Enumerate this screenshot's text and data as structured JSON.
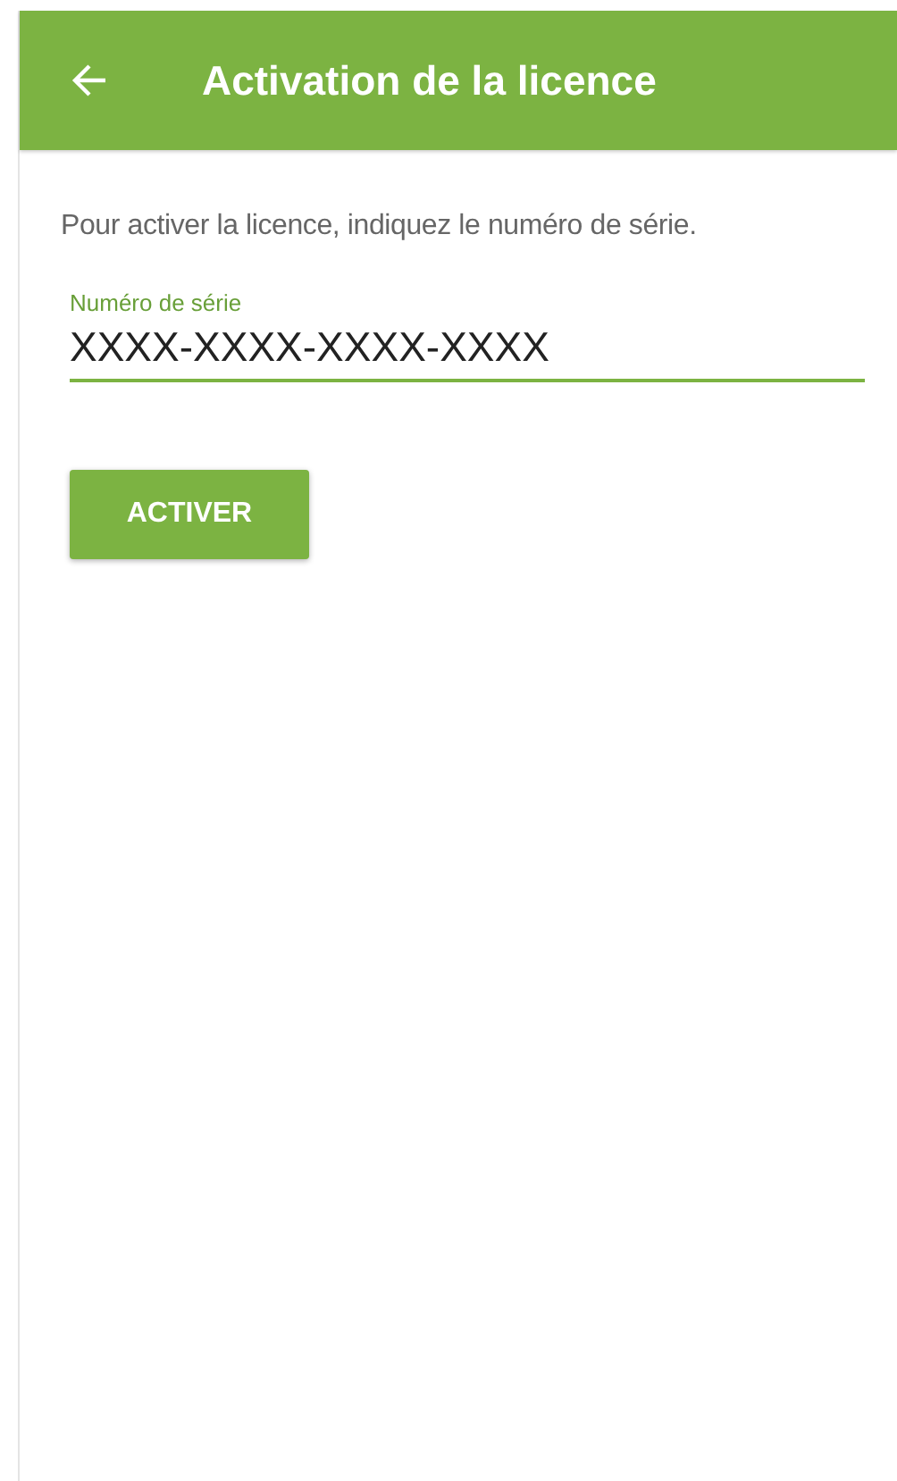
{
  "app_bar": {
    "title": "Activation de la licence"
  },
  "instructions": "Pour activer la licence, indiquez le numéro de série.",
  "serial_field": {
    "label": "Numéro de série",
    "value": "XXXX-XXXX-XXXX-XXXX",
    "focused": true
  },
  "activate_button": {
    "label": "ACTIVER"
  }
}
